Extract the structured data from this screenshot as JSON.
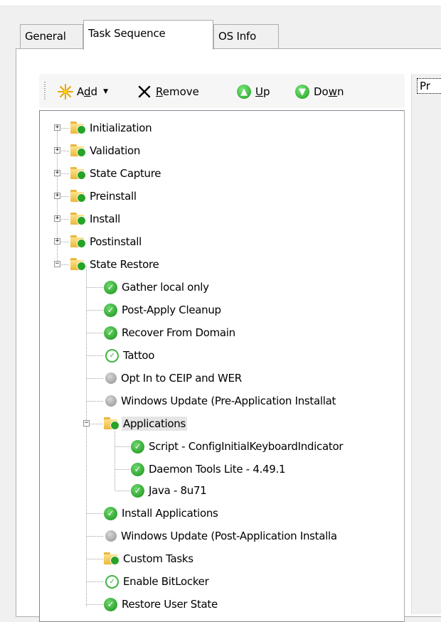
{
  "tabs": [
    {
      "label": "General",
      "selected": false
    },
    {
      "label": "Task Sequence",
      "selected": true
    },
    {
      "label": "OS Info",
      "selected": false
    }
  ],
  "toolbar": {
    "add_pre": "A",
    "add_ul": "d",
    "add_post": "d",
    "remove_ul": "R",
    "remove_post": "emove",
    "up_ul": "U",
    "up_post": "p",
    "down_pre": "Do",
    "down_ul": "w",
    "down_post": "n"
  },
  "right_panel": {
    "tab_label": "Pr"
  },
  "tree": {
    "groups": [
      {
        "label": "Initialization",
        "expanded": false
      },
      {
        "label": "Validation",
        "expanded": false
      },
      {
        "label": "State Capture",
        "expanded": false
      },
      {
        "label": "Preinstall",
        "expanded": false
      },
      {
        "label": "Install",
        "expanded": false
      },
      {
        "label": "Postinstall",
        "expanded": false
      },
      {
        "label": "State Restore",
        "expanded": true
      }
    ],
    "state_restore_items": [
      {
        "label": "Gather local only",
        "status": "enabled"
      },
      {
        "label": "Post-Apply Cleanup",
        "status": "enabled"
      },
      {
        "label": "Recover From Domain",
        "status": "enabled"
      },
      {
        "label": "Tattoo",
        "status": "light"
      },
      {
        "label": "Opt In to CEIP and WER",
        "status": "disabled"
      },
      {
        "label": "Windows Update (Pre-Application Installat",
        "status": "disabled"
      },
      {
        "label": "Applications",
        "status": "folder"
      },
      {
        "label": "Install Applications",
        "status": "enabled"
      },
      {
        "label": "Windows Update (Post-Application Installa",
        "status": "disabled"
      },
      {
        "label": "Custom Tasks",
        "status": "folder"
      },
      {
        "label": "Enable BitLocker",
        "status": "light"
      },
      {
        "label": "Restore User State",
        "status": "enabled"
      }
    ],
    "applications_items": [
      {
        "label": "Script - ConfigInitialKeyboardIndicator",
        "status": "enabled"
      },
      {
        "label": "Daemon Tools Lite - 4.49.1",
        "status": "enabled"
      },
      {
        "label": "Java - 8u71",
        "status": "enabled"
      }
    ]
  }
}
